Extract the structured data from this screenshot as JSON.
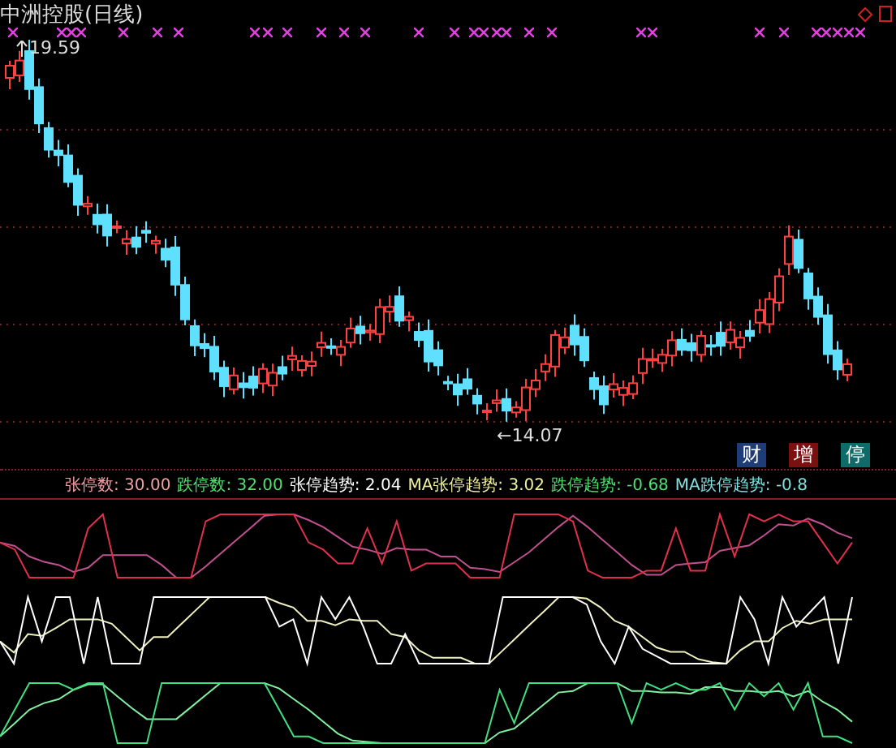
{
  "title": "中洲控股(日线)",
  "price_high": "19.59",
  "price_low": "←14.07",
  "badges": [
    {
      "label": "财",
      "color": "#1e3c78"
    },
    {
      "label": "增",
      "color": "#7a1010"
    },
    {
      "label": "停",
      "color": "#0f6a6a"
    }
  ],
  "legend": [
    {
      "label": "张停数: 30.00",
      "color": "#f0a0a0"
    },
    {
      "label": "跌停数: 32.00",
      "color": "#50e070"
    },
    {
      "label": "张停趋势: 2.04",
      "color": "#ffffff"
    },
    {
      "label": "MA张停趋势: 3.02",
      "color": "#f0f0a0"
    },
    {
      "label": "跌停趋势: -0.68",
      "color": "#50e070"
    },
    {
      "label": "MA跌停趋势: -0.8",
      "color": "#80e0e0"
    }
  ]
}
